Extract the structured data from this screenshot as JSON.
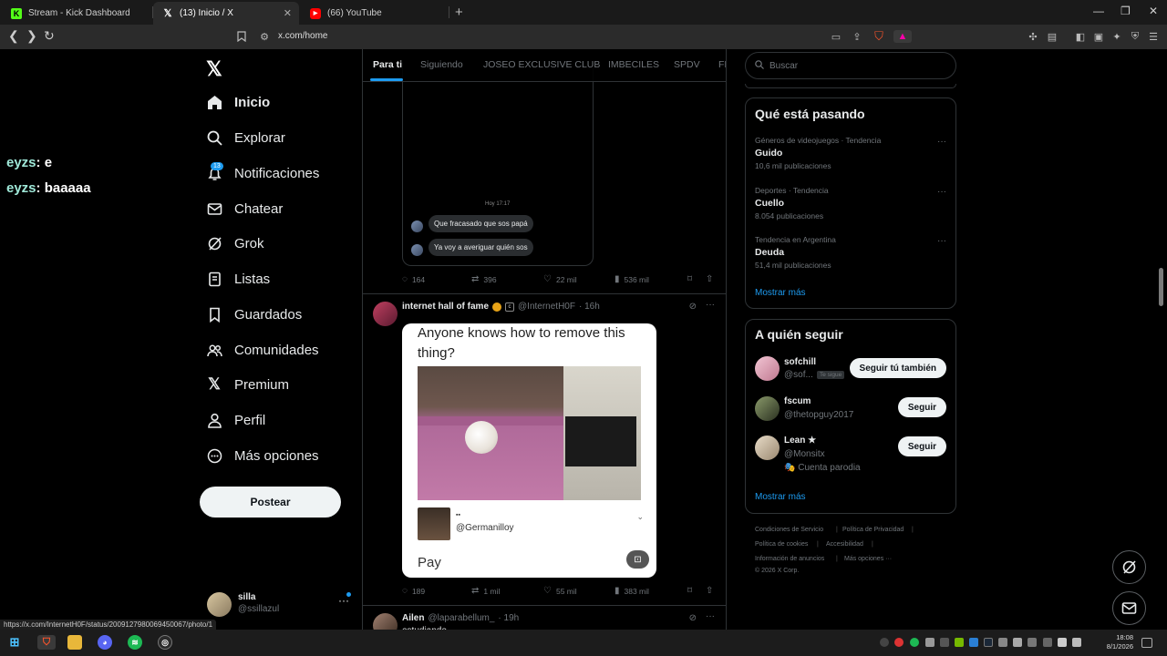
{
  "browser": {
    "tabs": [
      {
        "title": "Stream - Kick Dashboard",
        "icon": "kick-icon",
        "color": "#53fc18"
      },
      {
        "title": "(13) Inicio / X",
        "icon": "x-icon",
        "color": "#ffffff"
      },
      {
        "title": "(66) YouTube",
        "icon": "youtube-icon",
        "color": "#ff0000"
      }
    ],
    "url": "x.com/home",
    "status_url": "https://x.com/InternetH0F/status/2009127980069450067/photo/1"
  },
  "chat_overlay": [
    {
      "user": "eyzs",
      "message": ": e"
    },
    {
      "user": "eyzs",
      "message": ": baaaaa"
    }
  ],
  "nav": {
    "items": [
      {
        "label": "Inicio",
        "icon": "home-icon"
      },
      {
        "label": "Explorar",
        "icon": "search-icon"
      },
      {
        "label": "Notificaciones",
        "icon": "bell-icon"
      },
      {
        "label": "Chatear",
        "icon": "mail-icon"
      },
      {
        "label": "Grok",
        "icon": "grok-icon"
      },
      {
        "label": "Listas",
        "icon": "list-icon"
      },
      {
        "label": "Guardados",
        "icon": "bookmark-icon"
      },
      {
        "label": "Comunidades",
        "icon": "people-icon"
      },
      {
        "label": "Premium",
        "icon": "x-icon"
      },
      {
        "label": "Perfil",
        "icon": "person-icon"
      },
      {
        "label": "Más opciones",
        "icon": "more-circle-icon"
      }
    ],
    "notif_count": "13",
    "post_label": "Postear",
    "account": {
      "name": "silla",
      "handle": "@ssillazul"
    }
  },
  "feed": {
    "tabs": [
      "Para ti",
      "Siguiendo",
      "JOSEO EXCLUSIVE CLUB",
      "IMBECILES",
      "SPDV",
      "FI"
    ],
    "post1": {
      "time_label": "Hoy 17:17",
      "messages": [
        "Que fracasado que sos papá",
        "Ya voy a averiguar quién sos"
      ],
      "replies": "164",
      "reposts": "396",
      "likes": "22 mil",
      "views": "536 mil"
    },
    "post2": {
      "name": "internet hall of fame",
      "handle": "@InternetH0F",
      "time": "· 16h",
      "meme_question": "Anyone knows how to remove this thing?",
      "meme_user_handle": "@Germanilloy",
      "meme_footer": "Pay",
      "replies": "189",
      "reposts": "1 mil",
      "likes": "55 mil",
      "views": "383 mil"
    },
    "post3": {
      "name": "Ailen",
      "handle": "@laparabellum_",
      "time": "· 19h",
      "text": "estudiando"
    }
  },
  "sidebar": {
    "search_placeholder": "Buscar",
    "trends_title": "Qué está pasando",
    "trends": [
      {
        "meta": "Géneros de videojuegos · Tendencia",
        "name": "Guido",
        "count": "10,6 mil publicaciones"
      },
      {
        "meta": "Deportes · Tendencia",
        "name": "Cuello",
        "count": "8.054 publicaciones"
      },
      {
        "meta": "Tendencia en Argentina",
        "name": "Deuda",
        "count": "51,4 mil publicaciones"
      }
    ],
    "show_more": "Mostrar más",
    "who_title": "A quién seguir",
    "who": [
      {
        "name": "sofchill",
        "handle": "@sof...",
        "tag": "Te sigue",
        "button": "Seguir tú también"
      },
      {
        "name": "fscum",
        "handle": "@thetopguy2017",
        "button": "Seguir"
      },
      {
        "name": "Lean ★",
        "handle": "@Monsitx",
        "extra": "Cuenta parodia",
        "button": "Seguir"
      }
    ],
    "footer": {
      "row1": [
        "Condiciones de Servicio",
        "Política de Privacidad"
      ],
      "row2": [
        "Política de cookies",
        "Accesibilidad"
      ],
      "row3": [
        "Información de anuncios",
        "Más opciones ···"
      ],
      "copyright": "© 2026 X Corp."
    }
  },
  "taskbar": {
    "time": "18:08",
    "date": "8/1/2026"
  }
}
